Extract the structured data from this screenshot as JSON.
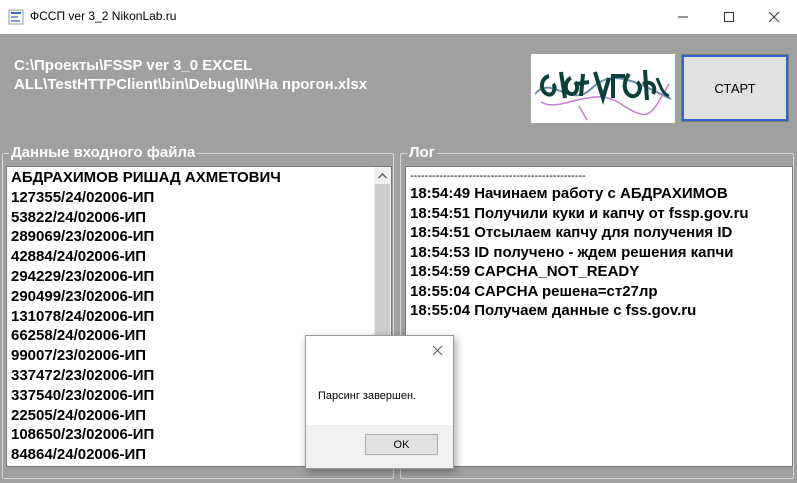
{
  "window": {
    "title": "ФССП ver 3_2  NikonLab.ru",
    "minimize_icon": "minimize-icon",
    "maximize_icon": "maximize-icon",
    "close_icon": "close-icon"
  },
  "header": {
    "file_path": "C:\\Проекты\\FSSP ver 3_0 EXCEL\nALL\\TestHTTPClient\\bin\\Debug\\IN\\На прогон.xlsx",
    "start_button": "СТАРТ"
  },
  "input_panel": {
    "legend": "Данные входного файла",
    "items": [
      "АБДРАХИМОВ РИШАД АХМЕТОВИЧ",
      "127355/24/02006-ИП",
      "53822/24/02006-ИП",
      "289069/23/02006-ИП",
      "42884/24/02006-ИП",
      "294229/23/02006-ИП",
      "290499/23/02006-ИП",
      "131078/24/02006-ИП",
      "66258/24/02006-ИП",
      "99007/23/02006-ИП",
      "337472/23/02006-ИП",
      "337540/23/02006-ИП",
      "22505/24/02006-ИП",
      "108650/23/02006-ИП",
      "84864/24/02006-ИП"
    ]
  },
  "log_panel": {
    "legend": "Лог",
    "lines": [
      "------------------------------------------------",
      "18:54:49 Начинаем работу с АБДРАХИМОВ",
      "18:54:51 Получили куки и капчу от fssp.gov.ru",
      "18:54:51 Отсылаем капчу для получения ID",
      "18:54:53 ID получено - ждем решения капчи",
      "18:54:59 CAPCHA_NOT_READY",
      "18:55:04 CAPCHA решена=ст27лр",
      "18:55:04 Получаем данные с fss.gov.ru"
    ]
  },
  "dialog": {
    "message": "Парсинг завершен.",
    "ok_button": "OK",
    "close_icon": "close-icon"
  }
}
